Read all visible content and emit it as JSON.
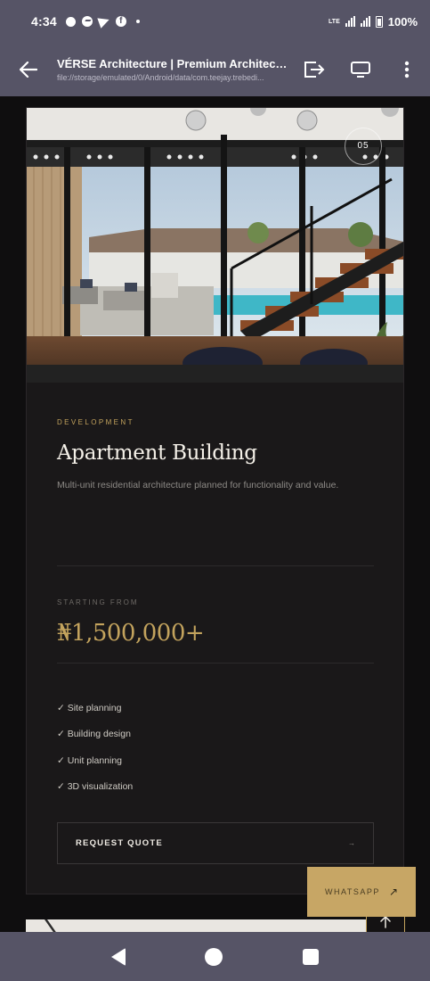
{
  "status_bar": {
    "time": "4:34",
    "network": "LTE",
    "battery": "100%"
  },
  "toolbar": {
    "title": "VÉRSE Architecture | Premium Architectu...",
    "url": "file://storage/emulated/0/Android/data/com.teejay.trebedi..."
  },
  "card": {
    "image_number": "05",
    "category": "DEVELOPMENT",
    "title": "Apartment Building",
    "description": "Multi-unit residential architecture planned for functionality and value.",
    "price_label": "STARTING FROM",
    "price": "₦1,500,000+",
    "features": [
      "✓ Site planning",
      "✓ Building design",
      "✓ Unit planning",
      "✓ 3D visualization"
    ],
    "cta_label": "REQUEST QUOTE",
    "cta_arrow": "→"
  },
  "floating": {
    "whatsapp_label": "WHATSAPP",
    "whatsapp_arrow": "↗"
  },
  "colors": {
    "accent_gold": "#c3a35d",
    "chrome": "#565466",
    "card_bg": "#1a1819"
  }
}
